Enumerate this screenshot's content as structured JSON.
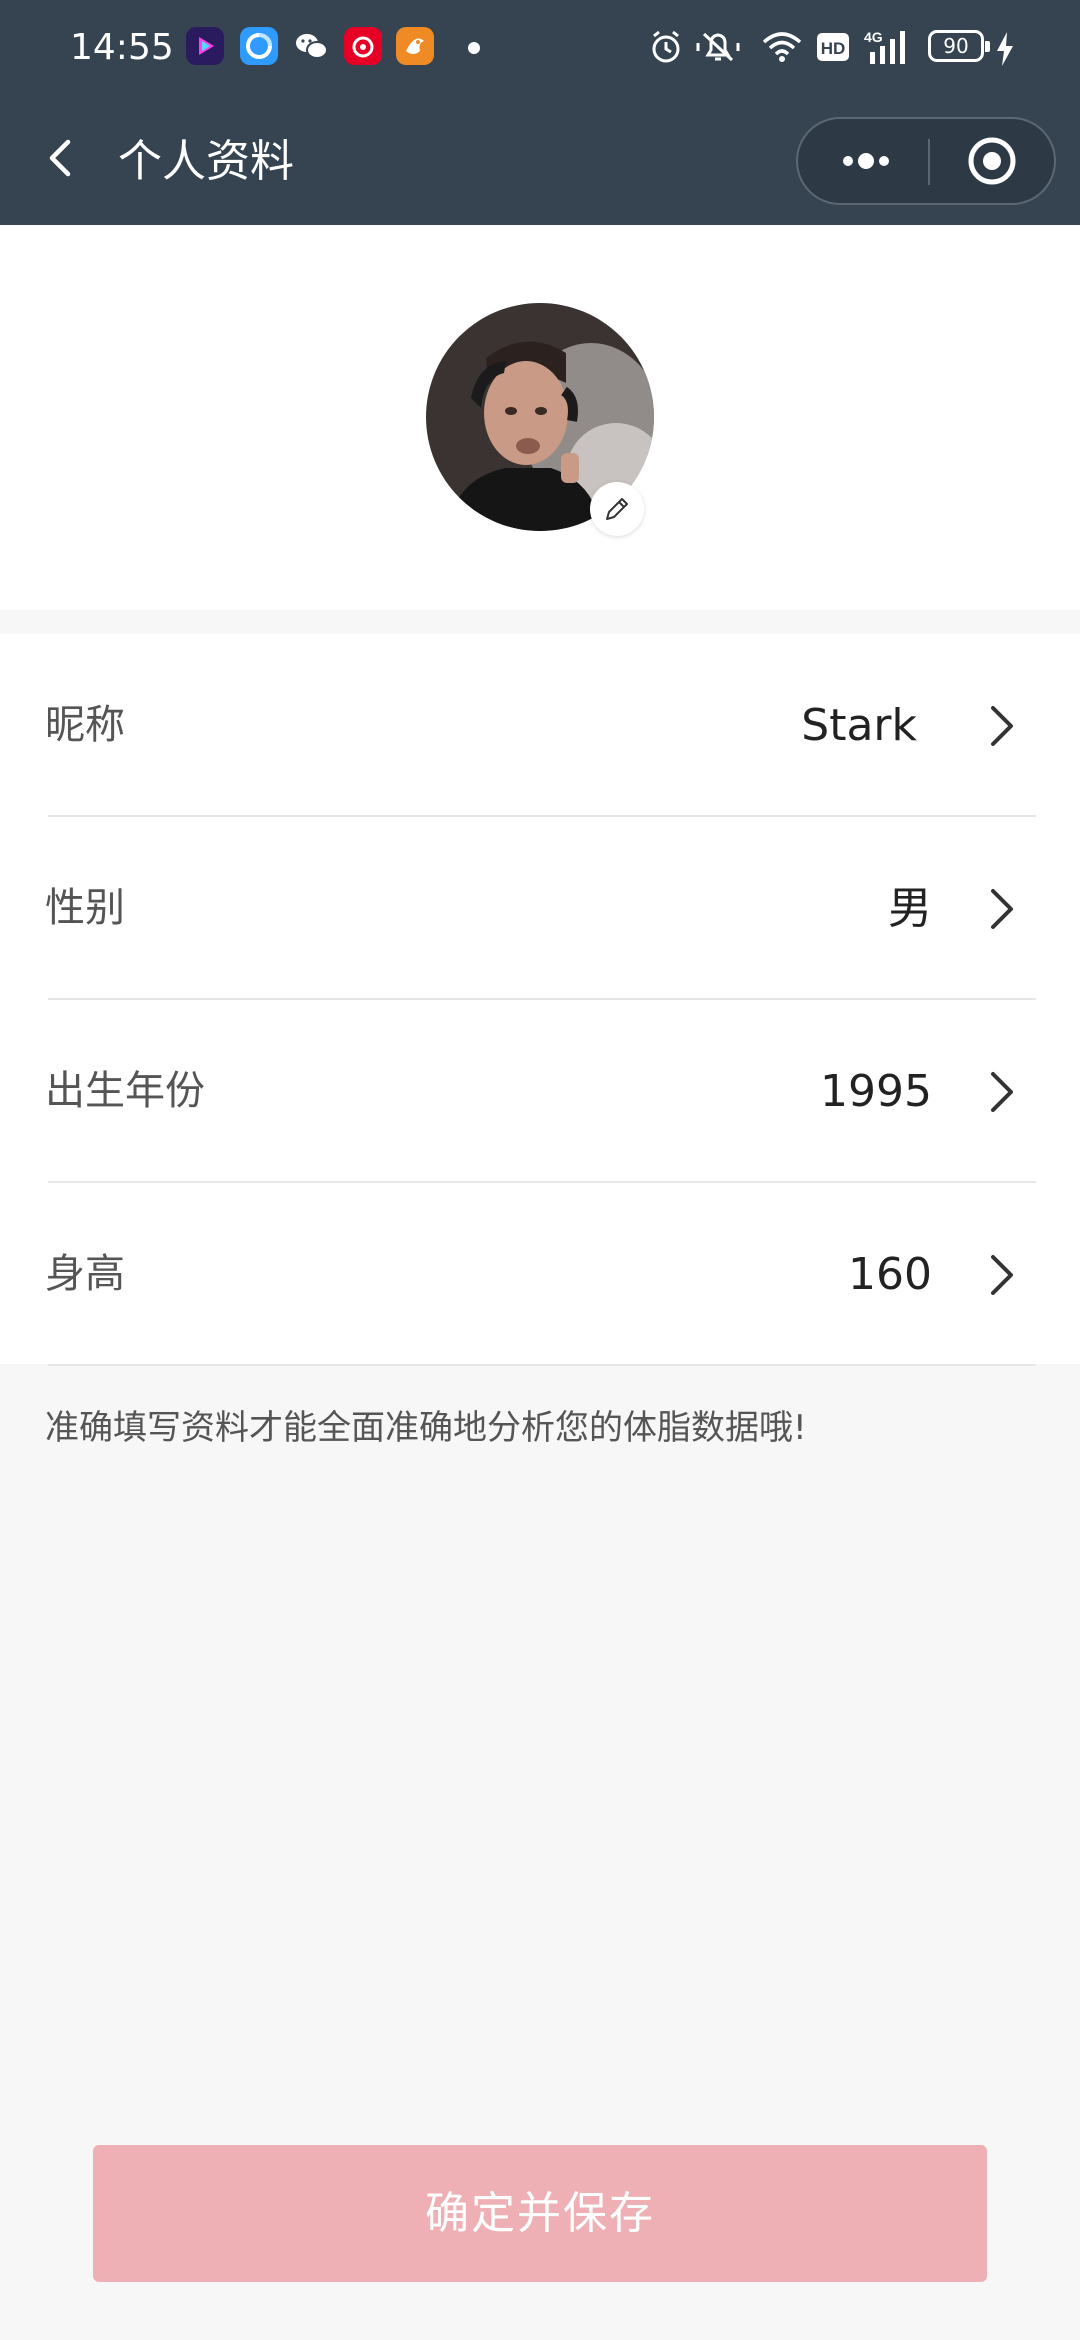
{
  "status_bar": {
    "time": "14:55",
    "notification_icons": [
      "video-app-icon",
      "browser-app-icon",
      "wechat-icon",
      "netease-music-icon",
      "game-app-icon"
    ],
    "system_icons": [
      "alarm-icon",
      "mute-icon",
      "wifi-icon",
      "hd-icon",
      "signal-4g-icon",
      "battery-icon",
      "charging-icon"
    ],
    "hd_label": "HD",
    "network_label": "4G",
    "battery_level": "90"
  },
  "nav": {
    "title": "个人资料",
    "back_icon": "chevron-left-icon",
    "menu_icon": "more-dots-icon",
    "close_icon": "target-icon"
  },
  "profile": {
    "avatar_icon": "avatar",
    "edit_icon": "pencil-icon",
    "fields": [
      {
        "label": "昵称",
        "value": "Stark"
      },
      {
        "label": "性别",
        "value": "男"
      },
      {
        "label": "出生年份",
        "value": "1995"
      },
      {
        "label": "身高",
        "value": "160"
      }
    ]
  },
  "hint": "准确填写资料才能全面准确地分析您的体脂数据哦!",
  "save_button": {
    "label": "确定并保存"
  },
  "colors": {
    "header_bg": "#364451",
    "page_bg": "#f7f7f7",
    "save_button_bg": "#eeb0b5"
  }
}
